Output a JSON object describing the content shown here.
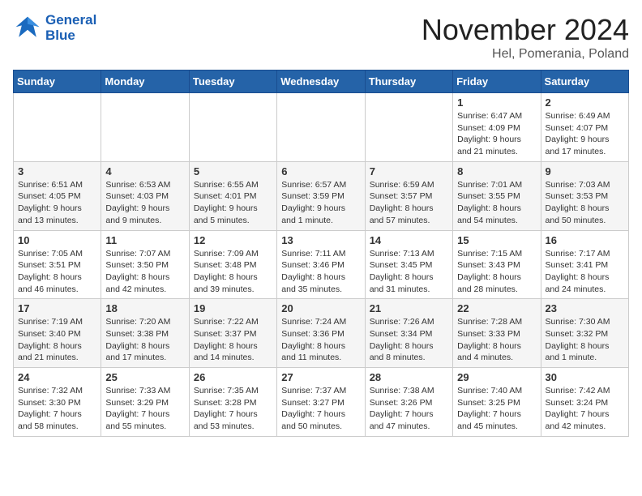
{
  "header": {
    "logo_line1": "General",
    "logo_line2": "Blue",
    "month_title": "November 2024",
    "location": "Hel, Pomerania, Poland"
  },
  "days_of_week": [
    "Sunday",
    "Monday",
    "Tuesday",
    "Wednesday",
    "Thursday",
    "Friday",
    "Saturday"
  ],
  "weeks": [
    [
      {
        "day": "",
        "info": ""
      },
      {
        "day": "",
        "info": ""
      },
      {
        "day": "",
        "info": ""
      },
      {
        "day": "",
        "info": ""
      },
      {
        "day": "",
        "info": ""
      },
      {
        "day": "1",
        "info": "Sunrise: 6:47 AM\nSunset: 4:09 PM\nDaylight: 9 hours and 21 minutes."
      },
      {
        "day": "2",
        "info": "Sunrise: 6:49 AM\nSunset: 4:07 PM\nDaylight: 9 hours and 17 minutes."
      }
    ],
    [
      {
        "day": "3",
        "info": "Sunrise: 6:51 AM\nSunset: 4:05 PM\nDaylight: 9 hours and 13 minutes."
      },
      {
        "day": "4",
        "info": "Sunrise: 6:53 AM\nSunset: 4:03 PM\nDaylight: 9 hours and 9 minutes."
      },
      {
        "day": "5",
        "info": "Sunrise: 6:55 AM\nSunset: 4:01 PM\nDaylight: 9 hours and 5 minutes."
      },
      {
        "day": "6",
        "info": "Sunrise: 6:57 AM\nSunset: 3:59 PM\nDaylight: 9 hours and 1 minute."
      },
      {
        "day": "7",
        "info": "Sunrise: 6:59 AM\nSunset: 3:57 PM\nDaylight: 8 hours and 57 minutes."
      },
      {
        "day": "8",
        "info": "Sunrise: 7:01 AM\nSunset: 3:55 PM\nDaylight: 8 hours and 54 minutes."
      },
      {
        "day": "9",
        "info": "Sunrise: 7:03 AM\nSunset: 3:53 PM\nDaylight: 8 hours and 50 minutes."
      }
    ],
    [
      {
        "day": "10",
        "info": "Sunrise: 7:05 AM\nSunset: 3:51 PM\nDaylight: 8 hours and 46 minutes."
      },
      {
        "day": "11",
        "info": "Sunrise: 7:07 AM\nSunset: 3:50 PM\nDaylight: 8 hours and 42 minutes."
      },
      {
        "day": "12",
        "info": "Sunrise: 7:09 AM\nSunset: 3:48 PM\nDaylight: 8 hours and 39 minutes."
      },
      {
        "day": "13",
        "info": "Sunrise: 7:11 AM\nSunset: 3:46 PM\nDaylight: 8 hours and 35 minutes."
      },
      {
        "day": "14",
        "info": "Sunrise: 7:13 AM\nSunset: 3:45 PM\nDaylight: 8 hours and 31 minutes."
      },
      {
        "day": "15",
        "info": "Sunrise: 7:15 AM\nSunset: 3:43 PM\nDaylight: 8 hours and 28 minutes."
      },
      {
        "day": "16",
        "info": "Sunrise: 7:17 AM\nSunset: 3:41 PM\nDaylight: 8 hours and 24 minutes."
      }
    ],
    [
      {
        "day": "17",
        "info": "Sunrise: 7:19 AM\nSunset: 3:40 PM\nDaylight: 8 hours and 21 minutes."
      },
      {
        "day": "18",
        "info": "Sunrise: 7:20 AM\nSunset: 3:38 PM\nDaylight: 8 hours and 17 minutes."
      },
      {
        "day": "19",
        "info": "Sunrise: 7:22 AM\nSunset: 3:37 PM\nDaylight: 8 hours and 14 minutes."
      },
      {
        "day": "20",
        "info": "Sunrise: 7:24 AM\nSunset: 3:36 PM\nDaylight: 8 hours and 11 minutes."
      },
      {
        "day": "21",
        "info": "Sunrise: 7:26 AM\nSunset: 3:34 PM\nDaylight: 8 hours and 8 minutes."
      },
      {
        "day": "22",
        "info": "Sunrise: 7:28 AM\nSunset: 3:33 PM\nDaylight: 8 hours and 4 minutes."
      },
      {
        "day": "23",
        "info": "Sunrise: 7:30 AM\nSunset: 3:32 PM\nDaylight: 8 hours and 1 minute."
      }
    ],
    [
      {
        "day": "24",
        "info": "Sunrise: 7:32 AM\nSunset: 3:30 PM\nDaylight: 7 hours and 58 minutes."
      },
      {
        "day": "25",
        "info": "Sunrise: 7:33 AM\nSunset: 3:29 PM\nDaylight: 7 hours and 55 minutes."
      },
      {
        "day": "26",
        "info": "Sunrise: 7:35 AM\nSunset: 3:28 PM\nDaylight: 7 hours and 53 minutes."
      },
      {
        "day": "27",
        "info": "Sunrise: 7:37 AM\nSunset: 3:27 PM\nDaylight: 7 hours and 50 minutes."
      },
      {
        "day": "28",
        "info": "Sunrise: 7:38 AM\nSunset: 3:26 PM\nDaylight: 7 hours and 47 minutes."
      },
      {
        "day": "29",
        "info": "Sunrise: 7:40 AM\nSunset: 3:25 PM\nDaylight: 7 hours and 45 minutes."
      },
      {
        "day": "30",
        "info": "Sunrise: 7:42 AM\nSunset: 3:24 PM\nDaylight: 7 hours and 42 minutes."
      }
    ]
  ]
}
